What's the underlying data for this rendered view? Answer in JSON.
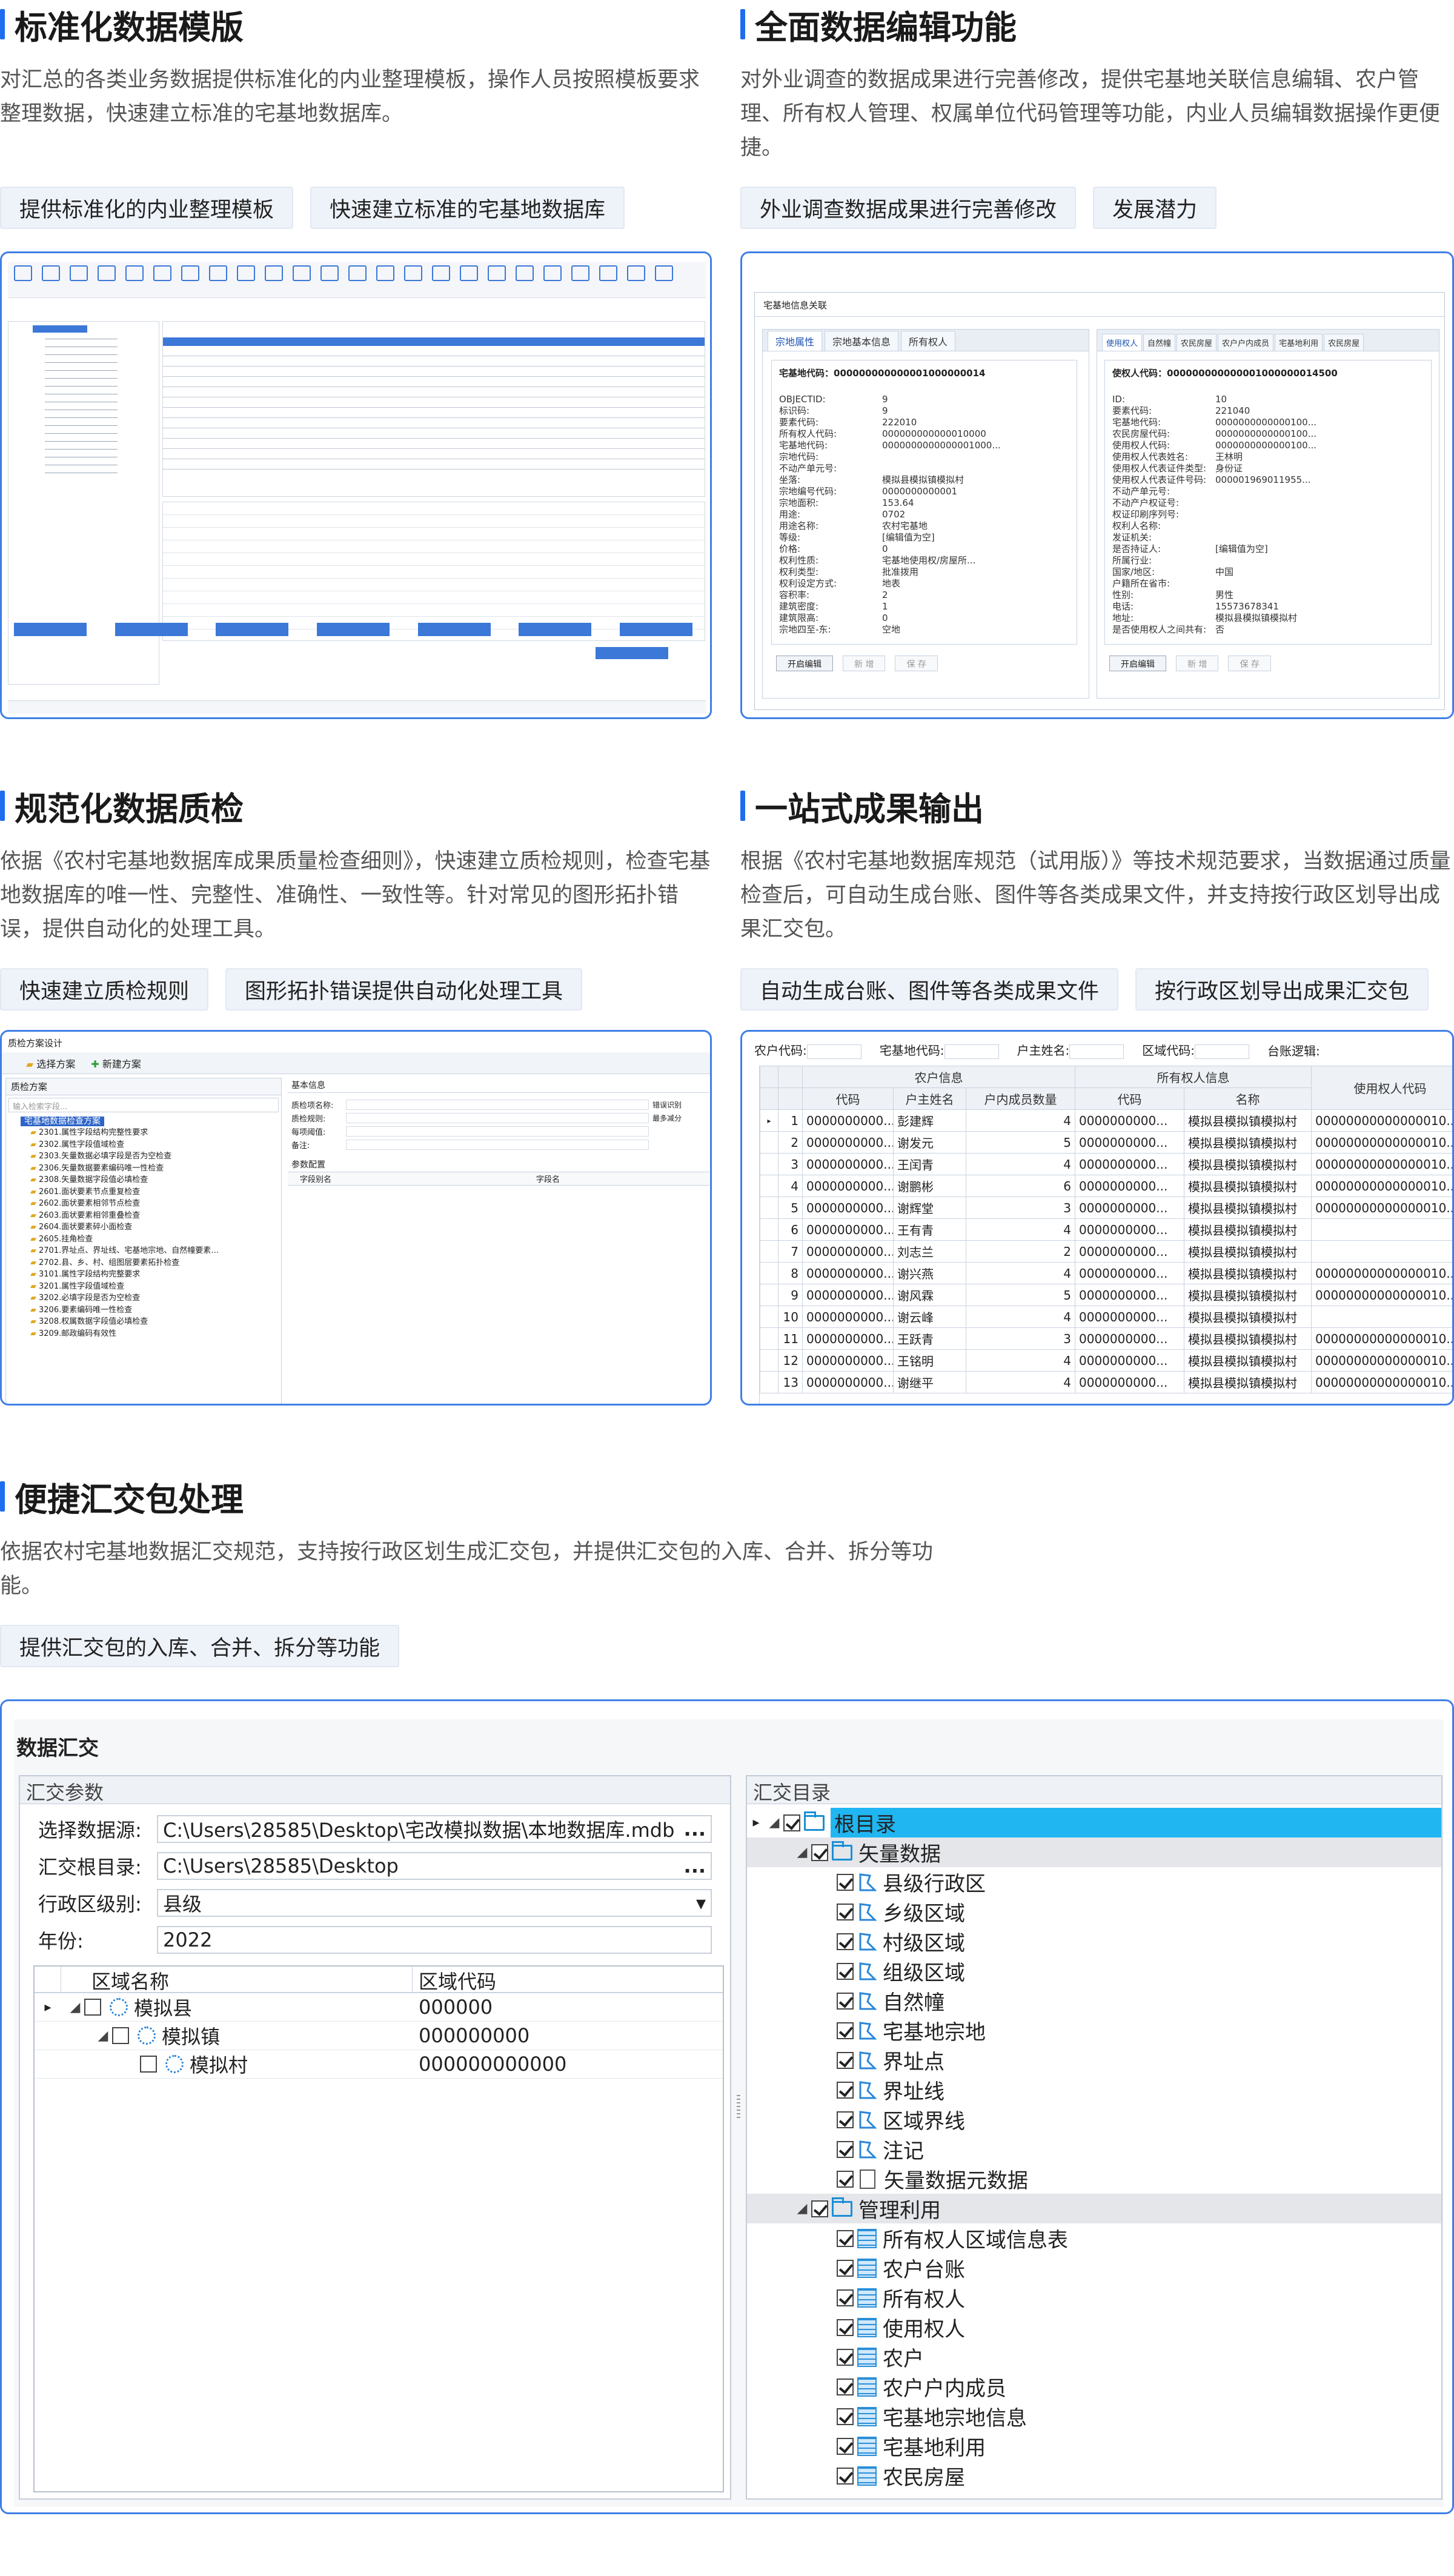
{
  "sections": {
    "s1": {
      "title": "标准化数据模版",
      "desc": "对汇总的各类业务数据提供标准化的内业整理模板，操作人员按照模板要求整理数据，快速建立标准的宅基地数据库。",
      "tags": [
        "提供标准化的内业整理模板",
        "快速建立标准的宅基地数据库"
      ]
    },
    "s2": {
      "title": "全面数据编辑功能",
      "desc": "对外业调查的数据成果进行完善修改，提供宅基地关联信息编辑、农户管理、所有权人管理、权属单位代码管理等功能，内业人员编辑数据操作更便捷。",
      "tags": [
        "外业调查数据成果进行完善修改",
        "发展潜力"
      ]
    },
    "s3": {
      "title": "规范化数据质检",
      "desc": "依据《农村宅基地数据库成果质量检查细则》，快速建立质检规则，检查宅基地数据库的唯一性、完整性、准确性、一致性等。针对常见的图形拓扑错误，提供自动化的处理工具。",
      "tags": [
        "快速建立质检规则",
        "图形拓扑错误提供自动化处理工具"
      ]
    },
    "s4": {
      "title": "一站式成果输出",
      "desc": "根据《农村宅基地数据库规范（试用版）》等技术规范要求，当数据通过质量检查后，可自动生成台账、图件等各类成果文件，并支持按行政区划导出成果汇交包。",
      "tags": [
        "自动生成台账、图件等各类成果文件",
        "按行政区划导出成果汇交包"
      ]
    },
    "s5": {
      "title": "便捷汇交包处理",
      "desc": "依据农村宅基地数据汇交规范，支持按行政区划生成汇交包，并提供汇交包的入库、合并、拆分等功能。",
      "tags": [
        "提供汇交包的入库、合并、拆分等功能"
      ]
    }
  },
  "shot2": {
    "title": "宅基地信息关联",
    "left_tabs": [
      "宗地属性",
      "宗地基本信息",
      "所有权人"
    ],
    "left_header": "宅基地代码：000000000000001000000014",
    "left_fields": [
      [
        "OBJECTID:",
        "9"
      ],
      [
        "标识码:",
        "9"
      ],
      [
        "要素代码:",
        "222010"
      ],
      [
        "所有权人代码:",
        "000000000000010000"
      ],
      [
        "宅基地代码:",
        "0000000000000001000..."
      ],
      [
        "宗地代码:",
        ""
      ],
      [
        "不动产单元号:",
        ""
      ],
      [
        "坐落:",
        "模拟县模拟镇模拟村"
      ],
      [
        "宗地编号代码:",
        "0000000000001"
      ],
      [
        "宗地面积:",
        "153.64"
      ],
      [
        "用途:",
        "0702"
      ],
      [
        "用途名称:",
        "农村宅基地"
      ],
      [
        "等级:",
        "[编辑值为空]"
      ],
      [
        "价格:",
        "0"
      ],
      [
        "权利性质:",
        "宅基地使用权/房屋所..."
      ],
      [
        "权利类型:",
        "批准拨用"
      ],
      [
        "权利设定方式:",
        "地表"
      ],
      [
        "容积率:",
        "2"
      ],
      [
        "建筑密度:",
        "1"
      ],
      [
        "建筑限高:",
        "0"
      ],
      [
        "宗地四至-东:",
        "空地"
      ]
    ],
    "left_buttons": [
      "开启编辑",
      "新 增",
      "保 存"
    ],
    "right_tabs": [
      "使用权人",
      "自然幢",
      "农民房屋",
      "农户户内成员",
      "宅基地利用",
      "农民房屋"
    ],
    "right_header": "使权人代码：000000000000001000000014500",
    "right_fields": [
      [
        "ID:",
        "10"
      ],
      [
        "要素代码:",
        "221040"
      ],
      [
        "宅基地代码:",
        "0000000000000100..."
      ],
      [
        "农民房屋代码:",
        "0000000000000100..."
      ],
      [
        "使用权人代码:",
        "0000000000000100..."
      ],
      [
        "使用权人代表姓名:",
        "王林明"
      ],
      [
        "使用权人代表证件类型:",
        "身份证"
      ],
      [
        "使用权人代表证件号码:",
        "000001969011955..."
      ],
      [
        "不动产单元号:",
        ""
      ],
      [
        "不动产户权证号:",
        ""
      ],
      [
        "权证印刷序列号:",
        ""
      ],
      [
        "权利人名称:",
        ""
      ],
      [
        "发证机关:",
        ""
      ],
      [
        "是否持证人:",
        "[编辑值为空]"
      ],
      [
        "所属行业:",
        ""
      ],
      [
        "国家/地区:",
        "中国"
      ],
      [
        "户籍所在省市:",
        ""
      ],
      [
        "性别:",
        "男性"
      ],
      [
        "电话:",
        "15573678341"
      ],
      [
        "地址:",
        "模拟县模拟镇模拟村"
      ],
      [
        "是否使用权人之间共有:",
        "否"
      ]
    ],
    "right_buttons": [
      "开启编辑",
      "新 增",
      "保 存"
    ]
  },
  "shot3": {
    "title": "质检方案设计",
    "toolbar": [
      "选择方案",
      "新建方案"
    ],
    "left_title": "质检方案",
    "search_placeholder": "输入检索字段...",
    "root": "宅基地数据检查方案",
    "rules": [
      "2301.属性字段结构完整性要求",
      "2302.属性字段值域检查",
      "2303.矢量数据必填字段是否为空检查",
      "2306.矢量数据要素编码唯一性检查",
      "2308.矢量数据字段值必填检查",
      "2601.面状要素节点重复检查",
      "2602.面状要素相邻节点检查",
      "2603.面状要素相邻重叠检查",
      "2604.面状要素碎小面检查",
      "2605.挂角检查",
      "2701.界址点、界址线、宅基地宗地、自然幢要素…",
      "2702.县、乡、村、组图层要素拓扑检查",
      "3101.属性字段结构完整要求",
      "3201.属性字段值域检查",
      "3202.必填字段是否为空检查",
      "3206.要素编码唯一性检查",
      "3208.权属数据字段值必填检查",
      "3209.邮政编码有效性"
    ],
    "basic_title": "基本信息",
    "basic_fields": [
      "质检项名称:",
      "质检规则:",
      "每项阈值:",
      "备注:"
    ],
    "basic_right": [
      "错误识别",
      "最多减分"
    ],
    "param_title": "参数配置",
    "param_cols": [
      "字段别名",
      "字段名"
    ]
  },
  "shot4": {
    "filters": [
      "农户代码:",
      "宅基地代码:",
      "户主姓名:",
      "区域代码:",
      "台账逻辑:"
    ],
    "groups": [
      "农户信息",
      "所有权人信息",
      "使用权人代码"
    ],
    "cols": [
      "代码",
      "户主姓名",
      "户内成员数量",
      "代码",
      "名称"
    ],
    "rows": [
      [
        "1",
        "0000000000...",
        "彭建辉",
        "4",
        "0000000000...",
        "模拟县模拟镇模拟村",
        "00000000000000010..."
      ],
      [
        "2",
        "0000000000...",
        "谢发元",
        "5",
        "0000000000...",
        "模拟县模拟镇模拟村",
        "00000000000000010..."
      ],
      [
        "3",
        "0000000000...",
        "王闰青",
        "4",
        "0000000000...",
        "模拟县模拟镇模拟村",
        "00000000000000010..."
      ],
      [
        "4",
        "0000000000...",
        "谢鹏彬",
        "6",
        "0000000000...",
        "模拟县模拟镇模拟村",
        "00000000000000010..."
      ],
      [
        "5",
        "0000000000...",
        "谢辉堂",
        "3",
        "0000000000...",
        "模拟县模拟镇模拟村",
        "00000000000000010..."
      ],
      [
        "6",
        "0000000000...",
        "王有青",
        "4",
        "0000000000...",
        "模拟县模拟镇模拟村",
        ""
      ],
      [
        "7",
        "0000000000...",
        "刘志兰",
        "2",
        "0000000000...",
        "模拟县模拟镇模拟村",
        ""
      ],
      [
        "8",
        "0000000000...",
        "谢兴燕",
        "4",
        "0000000000...",
        "模拟县模拟镇模拟村",
        "00000000000000010..."
      ],
      [
        "9",
        "0000000000...",
        "谢风霖",
        "5",
        "0000000000...",
        "模拟县模拟镇模拟村",
        "00000000000000010..."
      ],
      [
        "10",
        "0000000000...",
        "谢云峰",
        "4",
        "0000000000...",
        "模拟县模拟镇模拟村",
        ""
      ],
      [
        "11",
        "0000000000...",
        "王跃青",
        "3",
        "0000000000...",
        "模拟县模拟镇模拟村",
        "00000000000000010..."
      ],
      [
        "12",
        "0000000000...",
        "王铭明",
        "4",
        "0000000000...",
        "模拟县模拟镇模拟村",
        "00000000000000010..."
      ],
      [
        "13",
        "0000000000...",
        "谢继平",
        "4",
        "0000000000...",
        "模拟县模拟镇模拟村",
        "00000000000000010..."
      ]
    ]
  },
  "shot5": {
    "window_title": "数据汇交",
    "params_title": "汇交参数",
    "catalog_title": "汇交目录",
    "form": [
      {
        "label": "选择数据源:",
        "value": "C:\\Users\\28585\\Desktop\\宅改模拟数据\\本地数据库.mdb",
        "ctrl": "..."
      },
      {
        "label": "汇交根目录:",
        "value": "C:\\Users\\28585\\Desktop",
        "ctrl": "..."
      },
      {
        "label": "行政区级别:",
        "value": "县级",
        "ctrl": "▾"
      },
      {
        "label": "年份:",
        "value": "2022",
        "ctrl": ""
      }
    ],
    "region_cols": [
      "区域名称",
      "区域代码"
    ],
    "regions": [
      {
        "name": "模拟县",
        "code": "000000"
      },
      {
        "name": "模拟镇",
        "code": "000000000"
      },
      {
        "name": "模拟村",
        "code": "000000000000"
      }
    ],
    "tree": [
      {
        "label": "根目录",
        "level": 0,
        "icon": "folder",
        "sel": true
      },
      {
        "label": "矢量数据",
        "level": 1,
        "icon": "folder",
        "grp": true
      },
      {
        "label": "县级行政区",
        "level": 2,
        "icon": "poly"
      },
      {
        "label": "乡级区域",
        "level": 2,
        "icon": "poly"
      },
      {
        "label": "村级区域",
        "level": 2,
        "icon": "poly"
      },
      {
        "label": "组级区域",
        "level": 2,
        "icon": "poly"
      },
      {
        "label": "自然幢",
        "level": 2,
        "icon": "poly"
      },
      {
        "label": "宅基地宗地",
        "level": 2,
        "icon": "poly"
      },
      {
        "label": "界址点",
        "level": 2,
        "icon": "poly"
      },
      {
        "label": "界址线",
        "level": 2,
        "icon": "poly"
      },
      {
        "label": "区域界线",
        "level": 2,
        "icon": "poly"
      },
      {
        "label": "注记",
        "level": 2,
        "icon": "poly"
      },
      {
        "label": "矢量数据元数据",
        "level": 2,
        "icon": "doc"
      },
      {
        "label": "管理利用",
        "level": 1,
        "icon": "folder",
        "grp": true
      },
      {
        "label": "所有权人区域信息表",
        "level": 2,
        "icon": "tbl"
      },
      {
        "label": "农户台账",
        "level": 2,
        "icon": "tbl"
      },
      {
        "label": "所有权人",
        "level": 2,
        "icon": "tbl"
      },
      {
        "label": "使用权人",
        "level": 2,
        "icon": "tbl"
      },
      {
        "label": "农户",
        "level": 2,
        "icon": "tbl"
      },
      {
        "label": "农户户内成员",
        "level": 2,
        "icon": "tbl"
      },
      {
        "label": "宅基地宗地信息",
        "level": 2,
        "icon": "tbl"
      },
      {
        "label": "宅基地利用",
        "level": 2,
        "icon": "tbl"
      },
      {
        "label": "农民房屋",
        "level": 2,
        "icon": "tbl"
      }
    ]
  },
  "colors": {
    "accent": "#1e6cf0",
    "border": "#3f7fe6",
    "tag_bg": "#eef2f9",
    "selection": "#1fb6f2"
  }
}
